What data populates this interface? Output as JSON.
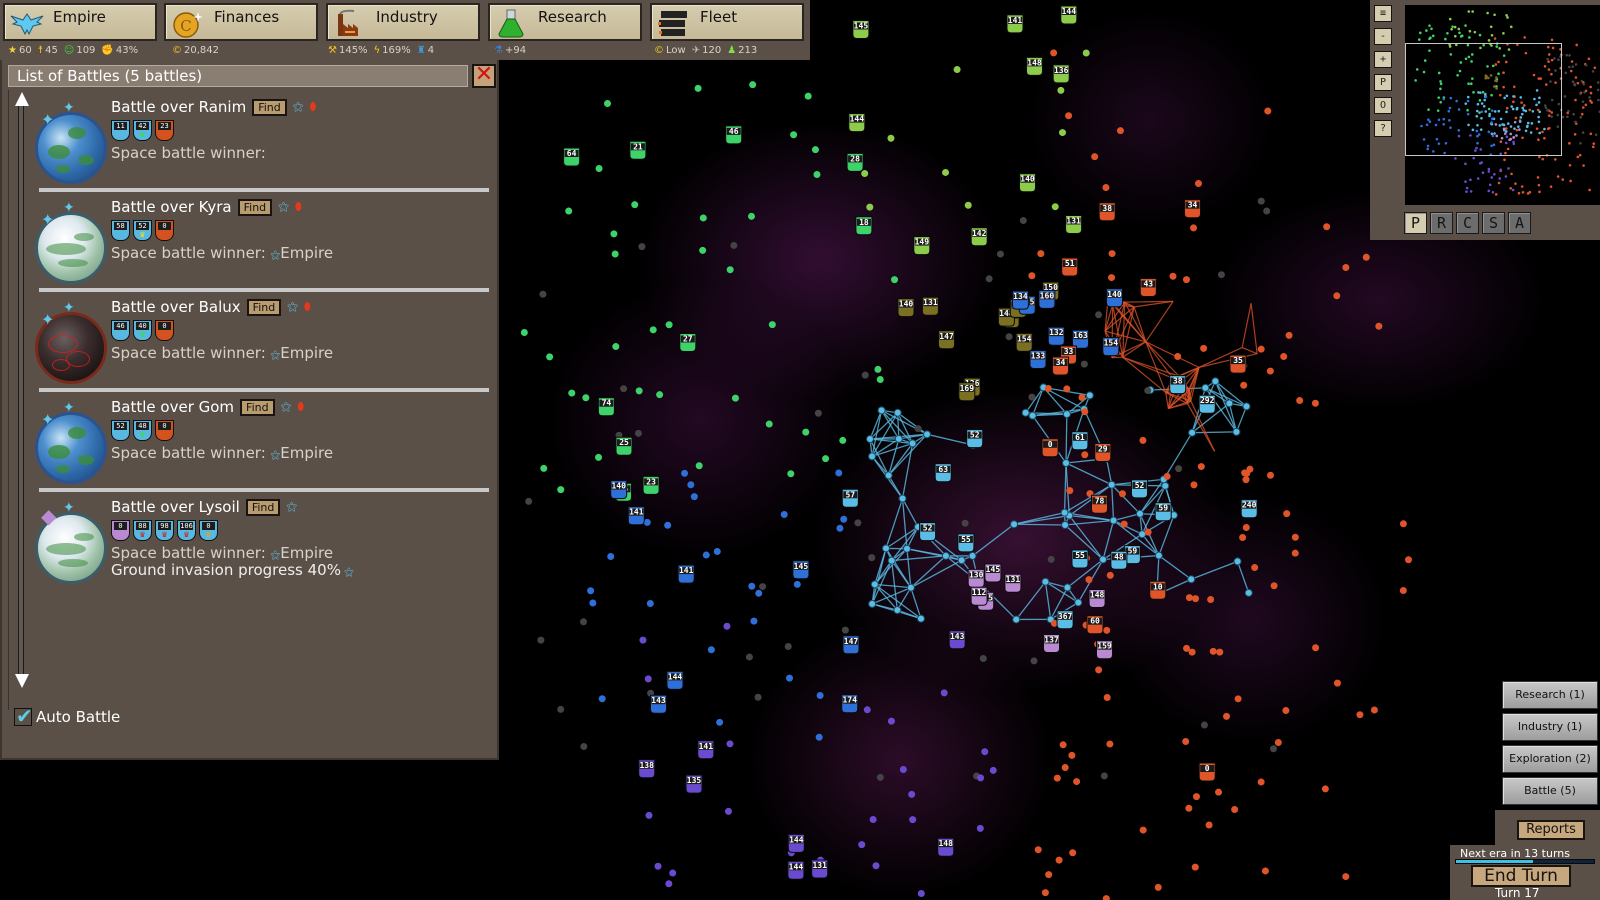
{
  "topbar": {
    "tabs": [
      {
        "label": "Empire",
        "icon": "eagle-icon"
      },
      {
        "label": "Finances",
        "icon": "coin-icon"
      },
      {
        "label": "Industry",
        "icon": "factory-icon"
      },
      {
        "label": "Research",
        "icon": "flask-icon"
      },
      {
        "label": "Fleet",
        "icon": "fleet-icon"
      }
    ],
    "stats": {
      "empire": [
        {
          "icon": "star-icon",
          "value": "60"
        },
        {
          "icon": "population-icon",
          "value": "45"
        },
        {
          "icon": "happiness-icon",
          "value": "109"
        },
        {
          "icon": "unrest-fist-icon",
          "value": "43%"
        }
      ],
      "finances": [
        {
          "icon": "credits-icon",
          "value": "20,842"
        }
      ],
      "industry": [
        {
          "icon": "production-icon",
          "value": "145%"
        },
        {
          "icon": "energy-icon",
          "value": "169%"
        },
        {
          "icon": "workers-icon",
          "value": "4"
        }
      ],
      "research": [
        {
          "icon": "research-flask-icon",
          "value": "+94"
        }
      ],
      "fleet": [
        {
          "icon": "upkeep-coin-icon",
          "value": "Low"
        },
        {
          "icon": "ship-count-icon",
          "value": "120"
        },
        {
          "icon": "troops-icon",
          "value": "213"
        }
      ]
    }
  },
  "battles_panel": {
    "title": "List of Battles (5 battles)",
    "find_label": "Find",
    "auto_battle_label": "Auto Battle",
    "auto_battle_checked": true,
    "battles": [
      {
        "title": "Battle over Ranim",
        "planet_type": "earth",
        "parties": [
          "empire",
          "enemy"
        ],
        "units": [
          {
            "color": "blue",
            "kind": "garrison",
            "count": "11"
          },
          {
            "color": "blue",
            "kind": "ship",
            "count": "42",
            "ship_color": "#39e039"
          },
          {
            "color": "orange",
            "kind": "ship",
            "count": "23",
            "ship_color": ""
          }
        ],
        "winner_label": "Space battle winner:",
        "winner": ""
      },
      {
        "title": "Battle over Kyra",
        "planet_type": "ice",
        "parties": [
          "empire",
          "enemy"
        ],
        "units": [
          {
            "color": "blue",
            "kind": "garrison",
            "count": "58"
          },
          {
            "color": "blue",
            "kind": "ship",
            "count": "52",
            "ship_color": "#f0e020"
          },
          {
            "color": "orange",
            "kind": "ship",
            "count": "0",
            "ship_color": ""
          }
        ],
        "winner_label": "Space battle winner:",
        "winner": "Empire"
      },
      {
        "title": "Battle over Balux",
        "planet_type": "lava",
        "parties": [
          "empire",
          "enemy"
        ],
        "units": [
          {
            "color": "blue",
            "kind": "garrison",
            "count": "46"
          },
          {
            "color": "blue",
            "kind": "ship",
            "count": "40",
            "ship_color": "#39e039"
          },
          {
            "color": "orange",
            "kind": "ship",
            "count": "0",
            "ship_color": ""
          }
        ],
        "winner_label": "Space battle winner:",
        "winner": "Empire"
      },
      {
        "title": "Battle over Gom",
        "planet_type": "earth",
        "parties": [
          "empire",
          "enemy"
        ],
        "units": [
          {
            "color": "blue",
            "kind": "garrison",
            "count": "52"
          },
          {
            "color": "blue",
            "kind": "ship",
            "count": "48",
            "ship_color": "#39e039"
          },
          {
            "color": "orange",
            "kind": "ship",
            "count": "0",
            "ship_color": ""
          }
        ],
        "winner_label": "Space battle winner:",
        "winner": "Empire"
      },
      {
        "title": "Battle over Lysoil",
        "planet_type": "ice",
        "parties": [
          "empire"
        ],
        "units": [
          {
            "color": "purple",
            "kind": "garrison",
            "count": "0"
          },
          {
            "color": "blue",
            "kind": "ship",
            "count": "88",
            "ship_color": "#d01818"
          },
          {
            "color": "blue",
            "kind": "ship",
            "count": "98",
            "ship_color": "#d01818"
          },
          {
            "color": "blue",
            "kind": "ship",
            "count": "106",
            "ship_color": "#d01818"
          },
          {
            "color": "blue",
            "kind": "ship",
            "count": "0",
            "ship_color": "#f0a020"
          }
        ],
        "winner_label": "Space battle winner:",
        "winner": "Empire",
        "invasion": "Ground invasion progress 40%"
      }
    ]
  },
  "minimap": {
    "buttons": [
      {
        "name": "menu",
        "glyph": "≡"
      },
      {
        "name": "zoom-out",
        "glyph": "-"
      },
      {
        "name": "zoom-in",
        "glyph": "+"
      },
      {
        "name": "p",
        "glyph": "P"
      },
      {
        "name": "o",
        "glyph": "O"
      },
      {
        "name": "help",
        "glyph": "?"
      }
    ],
    "tabs": [
      {
        "label": "P",
        "active": true
      },
      {
        "label": "R",
        "active": false
      },
      {
        "label": "C",
        "active": false
      },
      {
        "label": "S",
        "active": false
      },
      {
        "label": "A",
        "active": false
      }
    ]
  },
  "reports": {
    "buttons": [
      {
        "label": "Research (1)"
      },
      {
        "label": "Industry (1)"
      },
      {
        "label": "Exploration (2)"
      },
      {
        "label": "Battle (5)"
      }
    ],
    "reports_label": "Reports",
    "next_era": "Next era in 13 turns",
    "era_progress": 0.56,
    "end_turn_label": "End Turn",
    "turn_label": "Turn 17"
  },
  "map": {
    "faction_colors": {
      "green": "#3ed36a",
      "lime": "#8ccc4a",
      "olive": "#7b7022",
      "blue": "#2e6fd8",
      "cyan": "#5bbde6",
      "orange": "#e0542a",
      "purple": "#b98ad2",
      "violet": "#6a4bd0",
      "gray": "#444444"
    },
    "systems": [
      {
        "c": "lime",
        "l": "142"
      },
      {
        "c": "lime",
        "l": "144"
      },
      {
        "c": "lime",
        "l": "148"
      },
      {
        "c": "lime",
        "l": "149"
      },
      {
        "c": "green",
        "l": "18"
      },
      {
        "c": "lime",
        "l": "136"
      },
      {
        "c": "green",
        "l": "27"
      },
      {
        "c": "green",
        "l": "64"
      },
      {
        "c": "green",
        "l": "25"
      },
      {
        "c": "lime",
        "l": "145"
      },
      {
        "c": "lime",
        "l": "144"
      },
      {
        "c": "green",
        "l": "25"
      },
      {
        "c": "lime",
        "l": "141"
      },
      {
        "c": "lime",
        "l": "131"
      },
      {
        "c": "green",
        "l": "46"
      },
      {
        "c": "lime",
        "l": "140"
      },
      {
        "c": "green",
        "l": "74"
      },
      {
        "c": "green",
        "l": "21"
      },
      {
        "c": "green",
        "l": "28"
      },
      {
        "c": "olive",
        "l": "149"
      },
      {
        "c": "olive",
        "l": "148"
      },
      {
        "c": "olive",
        "l": "136"
      },
      {
        "c": "olive",
        "l": "142"
      },
      {
        "c": "olive",
        "l": "140"
      },
      {
        "c": "olive",
        "l": "131"
      },
      {
        "c": "olive",
        "l": "169"
      },
      {
        "c": "olive",
        "l": "150"
      },
      {
        "c": "olive",
        "l": "147"
      },
      {
        "c": "olive",
        "l": "154"
      },
      {
        "c": "blue",
        "l": "163"
      },
      {
        "c": "blue",
        "l": "133"
      },
      {
        "c": "blue",
        "l": "135"
      },
      {
        "c": "blue",
        "l": "132"
      },
      {
        "c": "blue",
        "l": "140"
      },
      {
        "c": "blue",
        "l": "154"
      },
      {
        "c": "blue",
        "l": "160"
      },
      {
        "c": "blue",
        "l": "134"
      },
      {
        "c": "orange",
        "l": "33"
      },
      {
        "c": "orange",
        "l": "0"
      },
      {
        "c": "orange",
        "l": "35"
      },
      {
        "c": "orange",
        "l": "60"
      },
      {
        "c": "orange",
        "l": "78"
      },
      {
        "c": "orange",
        "l": "0"
      },
      {
        "c": "green",
        "l": "23"
      },
      {
        "c": "cyan",
        "l": "57"
      },
      {
        "c": "cyan",
        "l": "59"
      },
      {
        "c": "cyan",
        "l": "59"
      },
      {
        "c": "cyan",
        "l": "240"
      },
      {
        "c": "cyan",
        "l": "52"
      },
      {
        "c": "cyan",
        "l": "38"
      },
      {
        "c": "cyan",
        "l": "48"
      },
      {
        "c": "cyan",
        "l": "367"
      },
      {
        "c": "cyan",
        "l": "61"
      },
      {
        "c": "cyan",
        "l": "292"
      },
      {
        "c": "cyan",
        "l": "55"
      },
      {
        "c": "cyan",
        "l": "55"
      },
      {
        "c": "cyan",
        "l": "63"
      },
      {
        "c": "cyan",
        "l": "52"
      },
      {
        "c": "cyan",
        "l": "52"
      },
      {
        "c": "purple",
        "l": "130"
      },
      {
        "c": "purple",
        "l": "145"
      },
      {
        "c": "purple",
        "l": "135"
      },
      {
        "c": "purple",
        "l": "137"
      },
      {
        "c": "purple",
        "l": "112"
      },
      {
        "c": "purple",
        "l": "148"
      },
      {
        "c": "purple",
        "l": "159"
      },
      {
        "c": "purple",
        "l": "131"
      },
      {
        "c": "violet",
        "l": "138"
      },
      {
        "c": "violet",
        "l": "135"
      },
      {
        "c": "orange",
        "l": "34"
      },
      {
        "c": "orange",
        "l": "29"
      },
      {
        "c": "orange",
        "l": "10"
      },
      {
        "c": "orange",
        "l": "43"
      },
      {
        "c": "orange",
        "l": "51"
      },
      {
        "c": "orange",
        "l": "38"
      },
      {
        "c": "blue",
        "l": "141"
      },
      {
        "c": "blue",
        "l": "144"
      },
      {
        "c": "blue",
        "l": "140"
      },
      {
        "c": "blue",
        "l": "141"
      },
      {
        "c": "blue",
        "l": "143"
      },
      {
        "c": "blue",
        "l": "147"
      },
      {
        "c": "blue",
        "l": "174"
      },
      {
        "c": "blue",
        "l": "145"
      },
      {
        "c": "violet",
        "l": "143"
      },
      {
        "c": "violet",
        "l": "148"
      },
      {
        "c": "violet",
        "l": "144"
      },
      {
        "c": "violet",
        "l": "141"
      },
      {
        "c": "violet",
        "l": "144"
      },
      {
        "c": "violet",
        "l": "131"
      },
      {
        "c": "orange",
        "l": "34"
      }
    ]
  }
}
